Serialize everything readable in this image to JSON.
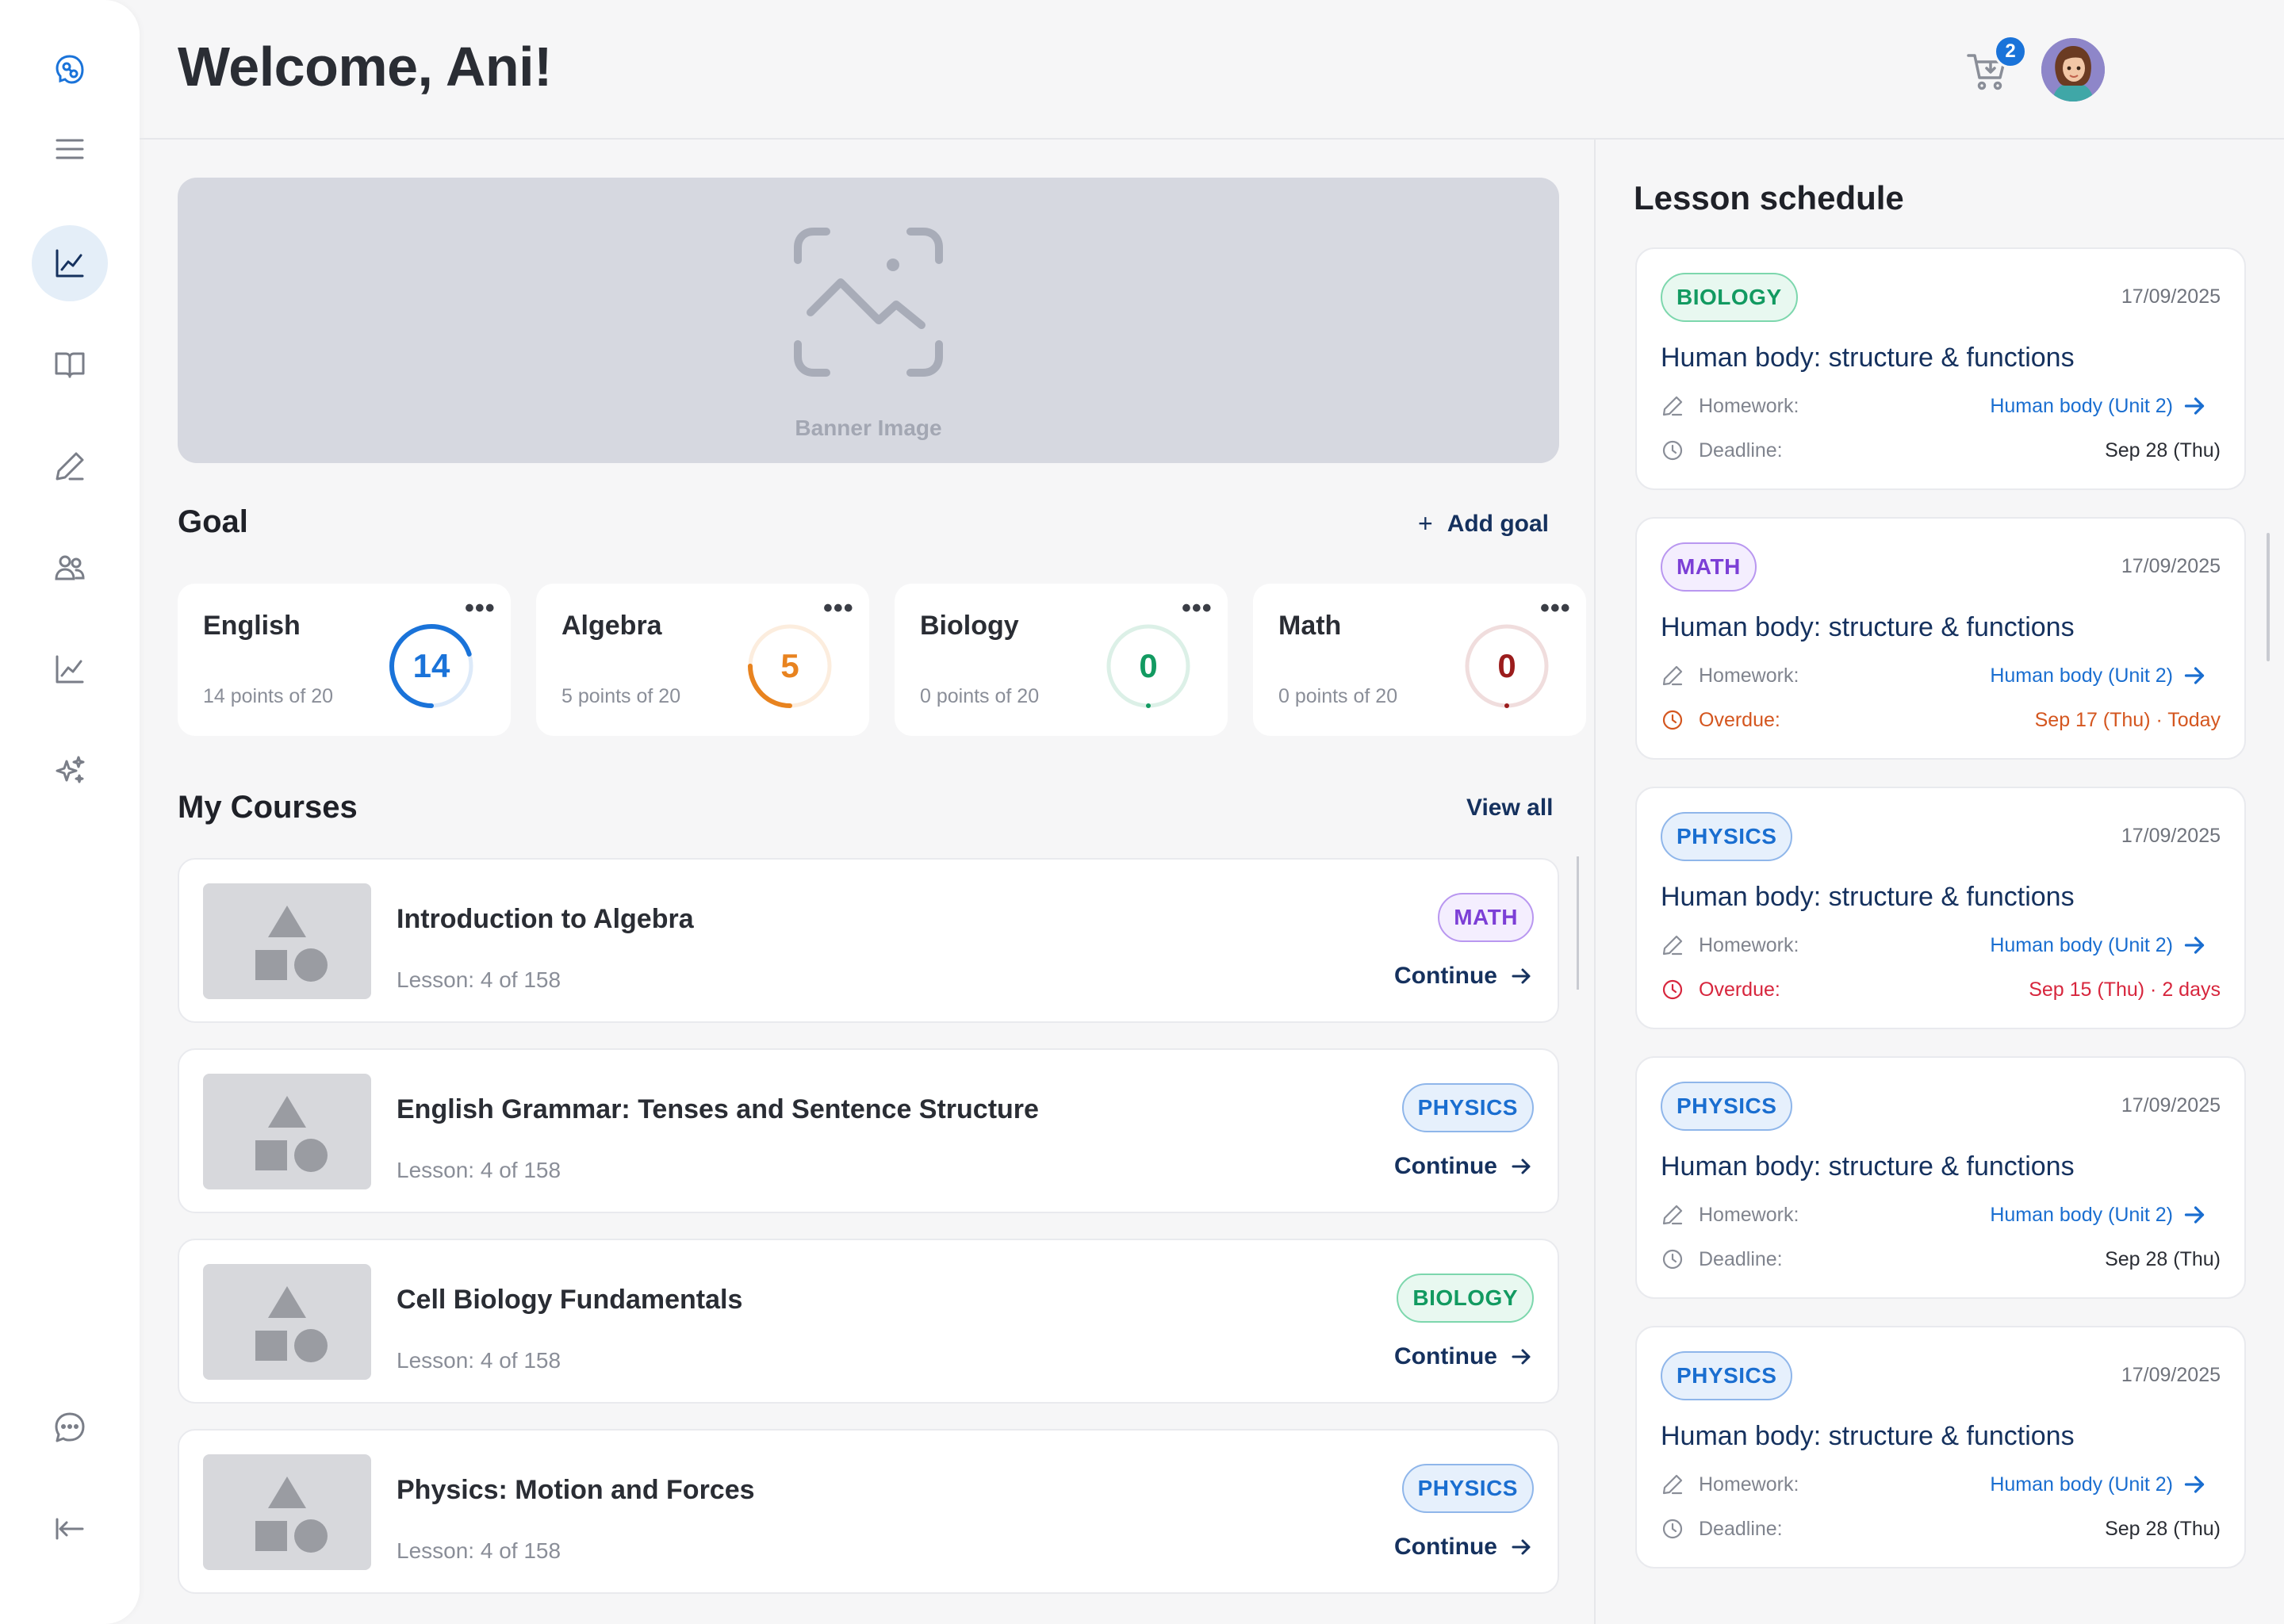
{
  "header": {
    "title": "Welcome, Ani!",
    "cart_count": "2"
  },
  "banner": {
    "label": "Banner Image"
  },
  "goals": {
    "title": "Goal",
    "add_label": "Add goal",
    "items": [
      {
        "name": "English",
        "points": 14,
        "total": 20,
        "sub": "14 points of 20",
        "value": "14",
        "color": "#1a73d9"
      },
      {
        "name": "Algebra",
        "points": 5,
        "total": 20,
        "sub": "5 points of 20",
        "value": "5",
        "color": "#e8831f"
      },
      {
        "name": "Biology",
        "points": 0,
        "total": 20,
        "sub": "0 points of 20",
        "value": "0",
        "color": "#129a61"
      },
      {
        "name": "Math",
        "points": 0,
        "total": 20,
        "sub": "0 points of 20",
        "value": "0",
        "color": "#9b1c1c"
      }
    ]
  },
  "courses": {
    "title": "My Courses",
    "view_all": "View all",
    "continue_label": "Continue",
    "items": [
      {
        "title": "Introduction to Algebra",
        "lesson": "Lesson: 4 of 158",
        "tag": "MATH"
      },
      {
        "title": "English Grammar: Tenses and Sentence Structure",
        "lesson": "Lesson: 4 of 158",
        "tag": "PHYSICS"
      },
      {
        "title": "Cell Biology Fundamentals",
        "lesson": "Lesson: 4 of 158",
        "tag": "BIOLOGY"
      },
      {
        "title": "Physics: Motion and Forces",
        "lesson": "Lesson: 4 of 158",
        "tag": "PHYSICS"
      }
    ]
  },
  "schedule": {
    "title": "Lesson schedule",
    "homework_label": "Homework:",
    "items": [
      {
        "tag": "BIOLOGY",
        "date": "17/09/2025",
        "title": "Human body: structure & functions",
        "homework": "Human body (Unit 2)",
        "status_label": "Deadline:",
        "status_value": "Sep 28 (Thu)"
      },
      {
        "tag": "MATH",
        "date": "17/09/2025",
        "title": "Human body: structure & functions",
        "homework": "Human body (Unit 2)",
        "status_label": "Overdue:",
        "status_value": "Sep 17 (Thu) · Today"
      },
      {
        "tag": "PHYSICS",
        "date": "17/09/2025",
        "title": "Human body: structure & functions",
        "homework": "Human body (Unit 2)",
        "status_label": "Overdue:",
        "status_value": "Sep 15 (Thu) · 2 days"
      },
      {
        "tag": "PHYSICS",
        "date": "17/09/2025",
        "title": "Human body: structure & functions",
        "homework": "Human body (Unit 2)",
        "status_label": "Deadline:",
        "status_value": "Sep 28 (Thu)"
      },
      {
        "tag": "PHYSICS",
        "date": "17/09/2025",
        "title": "Human body: structure & functions",
        "homework": "Human body (Unit 2)",
        "status_label": "Deadline:",
        "status_value": "Sep 28 (Thu)"
      }
    ]
  },
  "sidebar": {
    "icons": [
      "logo-icon",
      "menu-icon",
      "dashboard-chart-icon",
      "book-icon",
      "pencil-icon",
      "users-icon",
      "analytics-chart-icon",
      "sparkles-icon",
      "chat-icon",
      "collapse-icon"
    ]
  }
}
